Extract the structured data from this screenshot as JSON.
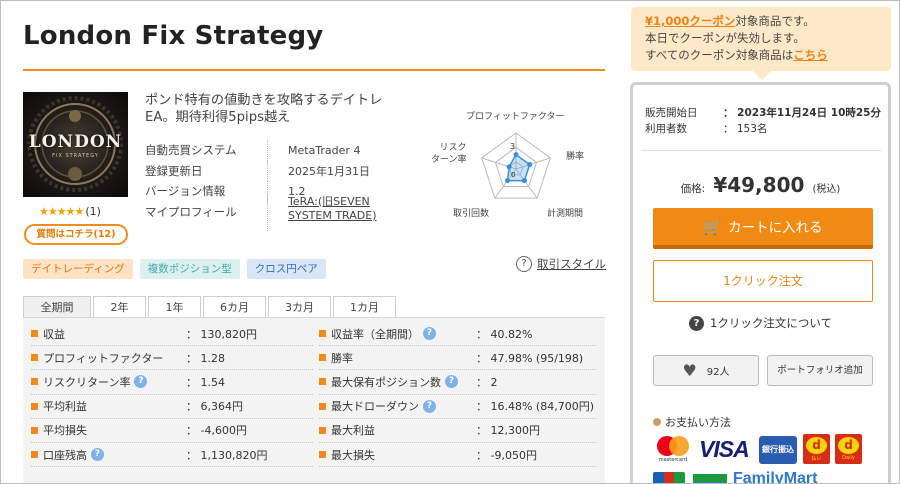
{
  "product": {
    "title": "London Fix Strategy",
    "logo_text": "LONDON",
    "logo_sub": "FIX STRATEGY",
    "stars": "★★★★★",
    "review_count": "(1)",
    "ask_button": "質問はコチラ(12)",
    "catch_copy": "ポンド特有の値動きを攻略するデイトレEA。期待利得5pips越え"
  },
  "spec": [
    {
      "key": "自動売買システム",
      "value": "MetaTrader 4"
    },
    {
      "key": "登録更新日",
      "value": "2025年1月31日"
    },
    {
      "key": "バージョン情報",
      "value": "1.2"
    },
    {
      "key": "マイプロフィール",
      "value": "TeRA:(旧SEVEN SYSTEM TRADE)"
    }
  ],
  "radar": {
    "labels": {
      "profit_factor": "プロフィットファクター",
      "win_rate": "勝率",
      "period": "計測期間",
      "trades": "取引回数",
      "risk_return": "リスク\nターン率"
    },
    "scale_max": 5,
    "scale_label": "3",
    "zero_label": "0",
    "values": {
      "profit_factor": 2,
      "win_rate": 2,
      "period": 2,
      "trades": 2,
      "risk_return": 1
    }
  },
  "tags": [
    "デイトレーディング",
    "複数ポジション型",
    "クロス円ペア"
  ],
  "trade_style": {
    "q": "?",
    "label": "取引スタイル"
  },
  "period_tabs": [
    {
      "label": "全期間",
      "active": true
    },
    {
      "label": "2年",
      "active": false
    },
    {
      "label": "1年",
      "active": false
    },
    {
      "label": "6カ月",
      "active": false
    },
    {
      "label": "3カ月",
      "active": false
    },
    {
      "label": "1カ月",
      "active": false
    }
  ],
  "stats_left": [
    {
      "label": "収益",
      "value": "： 130,820円",
      "help": false
    },
    {
      "label": "プロフィットファクター",
      "value": "： 1.28",
      "help": false
    },
    {
      "label": "リスクリターン率",
      "value": "： 1.54",
      "help": true
    },
    {
      "label": "平均利益",
      "value": "： 6,364円",
      "help": false
    },
    {
      "label": "平均損失",
      "value": "： -4,600円",
      "help": false
    },
    {
      "label": "口座残高",
      "value": "： 1,130,820円",
      "help": true
    }
  ],
  "stats_right": [
    {
      "label": "収益率（全期間）",
      "value": "： 40.82%",
      "help": true
    },
    {
      "label": "勝率",
      "value": "： 47.98% (95/198)",
      "help": false
    },
    {
      "label": "最大保有ポジション数",
      "value": "： 2",
      "help": true
    },
    {
      "label": "最大ドローダウン",
      "value": "： 16.48% (84,700円)",
      "help": true
    },
    {
      "label": "最大利益",
      "value": "： 12,300円",
      "help": false
    },
    {
      "label": "最大損失",
      "value": "： -9,050円",
      "help": false
    }
  ],
  "coupon": {
    "line1_highlight": "¥1,000クーポン",
    "line1_rest": "対象商品です。",
    "line2": "本日でクーポンが失効します。",
    "line3_pre": "すべてのクーポン対象商品は",
    "line3_link": "こちら"
  },
  "buy": {
    "meta": [
      {
        "key": "販売開始日",
        "value": "： 2023年11月24日 10時25分"
      },
      {
        "key": "利用者数",
        "value": "： 153名"
      }
    ],
    "price_label": "価格:",
    "price_value": "¥49,800",
    "price_tax": "(税込)",
    "cart_icon": "🛒",
    "cart_button": "カートに入れる",
    "oneclick_button": "1クリック注文",
    "about_q": "?",
    "about_oneclick": "1クリック注文について",
    "fav_icon": "♥",
    "fav_count": "92人",
    "portfolio_button": "ポートフォリオ追加",
    "payment_title": "お支払い方法",
    "pay_mastercard": "mastercard",
    "pay_visa": "VISA",
    "pay_bank": "銀行振込",
    "pay_d1": "d",
    "pay_d1_sub": "払い",
    "pay_d2": "d",
    "pay_d2_sub": "Daily",
    "pay_family": "FamilyMart"
  }
}
